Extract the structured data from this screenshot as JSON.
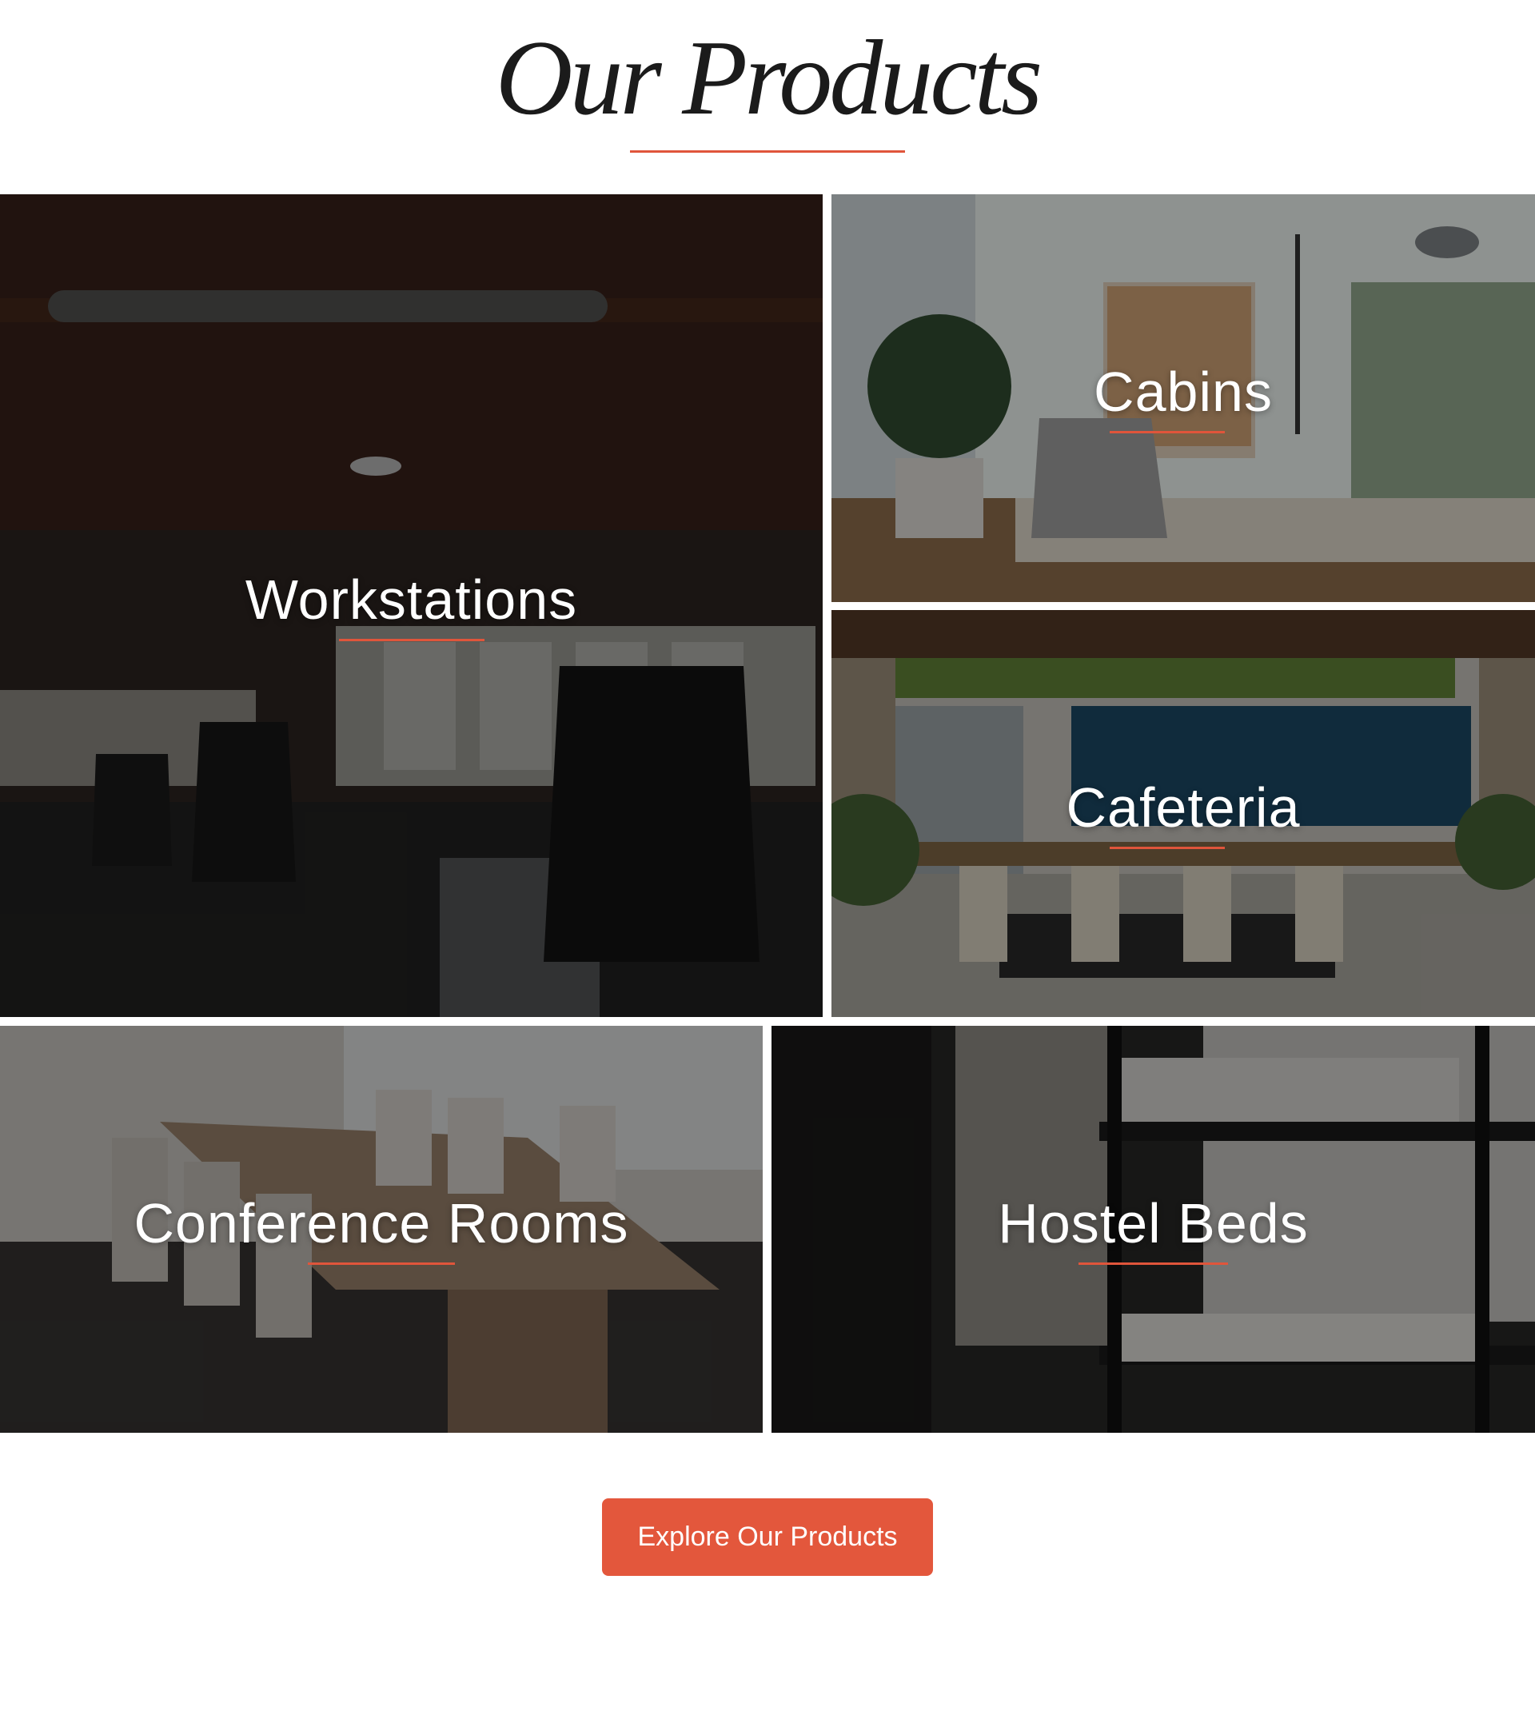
{
  "section": {
    "title": "Our Products",
    "accent_color": "#e0553b"
  },
  "tiles": [
    {
      "label": "Workstations",
      "scene": "open office workstations with mesh chairs"
    },
    {
      "label": "Cabins",
      "scene": "private cabin desk with monitor, laptop and plant"
    },
    {
      "label": "Cafeteria",
      "scene": "cafeteria with long tables and plants"
    },
    {
      "label": "Conference Rooms",
      "scene": "conference room with wooden table and chairs"
    },
    {
      "label": "Hostel Beds",
      "scene": "hostel room with bunk beds"
    }
  ],
  "cta": {
    "label": "Explore Our Products",
    "color": "#e3573c"
  }
}
